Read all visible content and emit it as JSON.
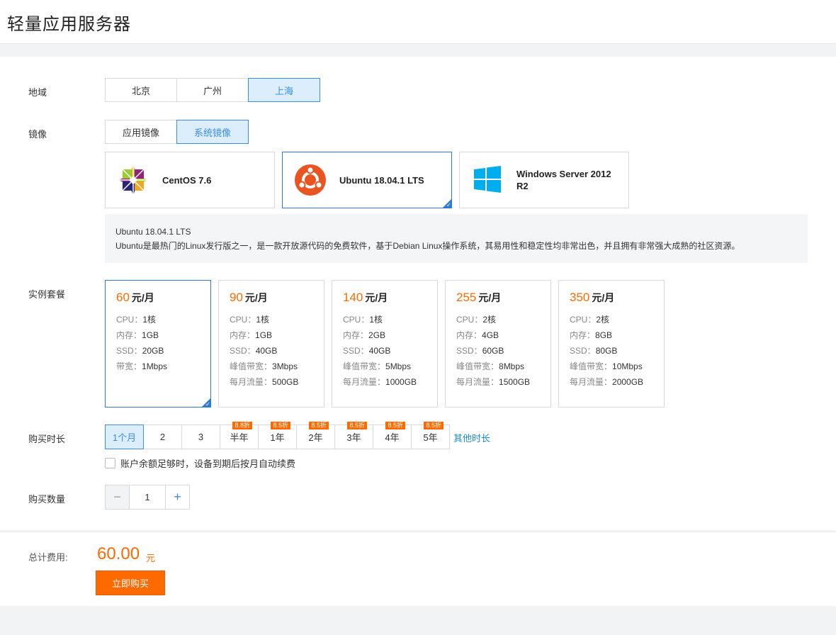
{
  "header": {
    "title": "轻量应用服务器"
  },
  "region": {
    "label": "地域",
    "options": [
      "北京",
      "广州",
      "上海"
    ],
    "selected": "上海"
  },
  "image": {
    "label": "镜像",
    "tabs": [
      "应用镜像",
      "系统镜像"
    ],
    "selected_tab": "系统镜像",
    "os_options": [
      {
        "name": "CentOS 7.6",
        "icon": "centos-logo-icon"
      },
      {
        "name": "Ubuntu 18.04.1 LTS",
        "icon": "ubuntu-logo-icon"
      },
      {
        "name": "Windows Server 2012 R2",
        "icon": "windows-logo-icon"
      }
    ],
    "selected_os": "Ubuntu 18.04.1 LTS",
    "description_title": "Ubuntu 18.04.1 LTS",
    "description_text": "Ubuntu是最热门的Linux发行版之一，是一款开放源代码的免费软件，基于Debian Linux操作系统，其易用性和稳定性均非常出色，并且拥有非常强大成熟的社区资源。"
  },
  "packages": {
    "label": "实例套餐",
    "unit": "元/月",
    "items": [
      {
        "price": "60",
        "specs": [
          [
            "CPU：",
            "1核"
          ],
          [
            "内存：",
            "1GB"
          ],
          [
            "SSD：",
            "20GB"
          ],
          [
            "带宽：",
            "1Mbps"
          ]
        ]
      },
      {
        "price": "90",
        "specs": [
          [
            "CPU：",
            "1核"
          ],
          [
            "内存：",
            "1GB"
          ],
          [
            "SSD：",
            "40GB"
          ],
          [
            "峰值带宽：",
            "3Mbps"
          ],
          [
            "每月流量：",
            "500GB"
          ]
        ]
      },
      {
        "price": "140",
        "specs": [
          [
            "CPU：",
            "1核"
          ],
          [
            "内存：",
            "2GB"
          ],
          [
            "SSD：",
            "40GB"
          ],
          [
            "峰值带宽：",
            "5Mbps"
          ],
          [
            "每月流量：",
            "1000GB"
          ]
        ]
      },
      {
        "price": "255",
        "specs": [
          [
            "CPU：",
            "2核"
          ],
          [
            "内存：",
            "4GB"
          ],
          [
            "SSD：",
            "60GB"
          ],
          [
            "峰值带宽：",
            "8Mbps"
          ],
          [
            "每月流量：",
            "1500GB"
          ]
        ]
      },
      {
        "price": "350",
        "specs": [
          [
            "CPU：",
            "2核"
          ],
          [
            "内存：",
            "8GB"
          ],
          [
            "SSD：",
            "80GB"
          ],
          [
            "峰值带宽：",
            "10Mbps"
          ],
          [
            "每月流量：",
            "2000GB"
          ]
        ]
      }
    ],
    "selected_index": 0
  },
  "duration": {
    "label": "购买时长",
    "options": [
      {
        "label": "1个月",
        "badge": ""
      },
      {
        "label": "2",
        "badge": ""
      },
      {
        "label": "3",
        "badge": ""
      },
      {
        "label": "半年",
        "badge": "8.8折"
      },
      {
        "label": "1年",
        "badge": "8.5折"
      },
      {
        "label": "2年",
        "badge": "8.5折"
      },
      {
        "label": "3年",
        "badge": "8.5折"
      },
      {
        "label": "4年",
        "badge": "8.5折"
      },
      {
        "label": "5年",
        "badge": "8.5折"
      }
    ],
    "selected": "1个月",
    "other_link": "其他时长",
    "auto_renew_label": "账户余额足够时，设备到期后按月自动续费",
    "auto_renew_checked": false
  },
  "quantity": {
    "label": "购买数量",
    "value": "1",
    "minus": "−",
    "plus": "+"
  },
  "footer": {
    "total_label": "总计费用:",
    "total_value": "60.00",
    "total_unit": "元",
    "buy_button": "立即购买"
  },
  "colors": {
    "accent_blue": "#3a8ee6",
    "accent_orange": "#ff6a00",
    "selected_bg": "#dcedfb"
  }
}
